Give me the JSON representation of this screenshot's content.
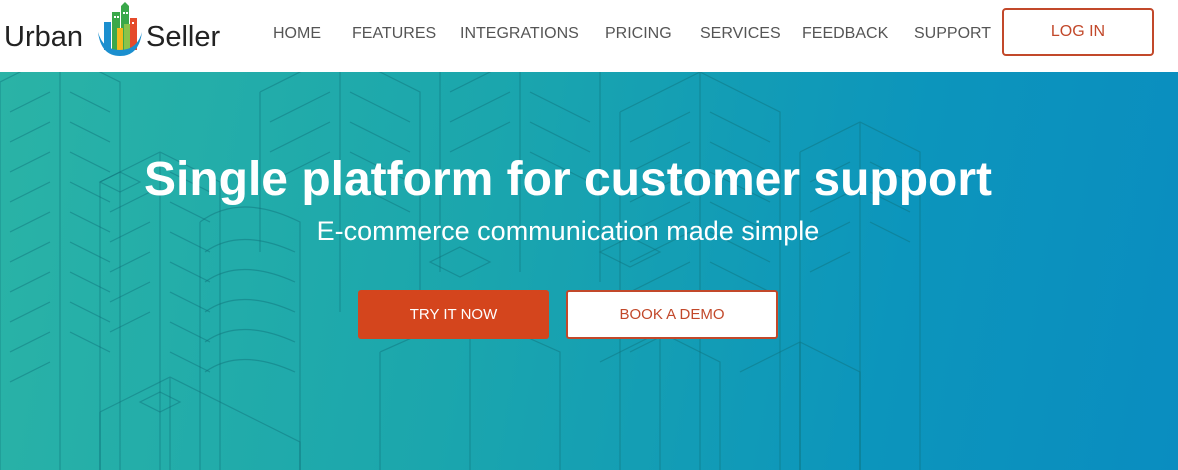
{
  "brand": {
    "word_1": "Urban",
    "word_2": "Seller",
    "logo_colors": [
      "#3aa84a",
      "#e54b2b",
      "#f3b81d",
      "#1b8fcf",
      "#8bc34a"
    ]
  },
  "nav": {
    "items": [
      {
        "label": "HOME"
      },
      {
        "label": "FEATURES"
      },
      {
        "label": "INTEGRATIONS"
      },
      {
        "label": "PRICING"
      },
      {
        "label": "SERVICES"
      },
      {
        "label": "FEEDBACK"
      },
      {
        "label": "SUPPORT"
      }
    ],
    "login_label": "LOG IN"
  },
  "hero": {
    "title": "Single platform for customer support",
    "subtitle": "E-commerce communication made simple",
    "primary_cta": "TRY IT NOW",
    "secondary_cta": "BOOK A DEMO"
  },
  "colors": {
    "accent": "#d4451d",
    "accent_border": "#c2482a",
    "hero_start": "#2ab3a6",
    "hero_end": "#0a8dc0",
    "nav_text": "#555555"
  }
}
